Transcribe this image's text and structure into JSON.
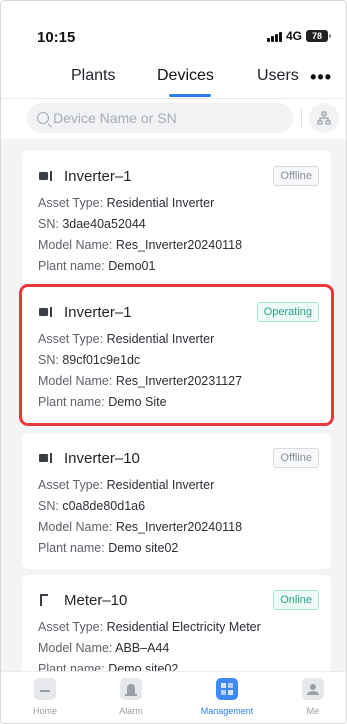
{
  "status_bar": {
    "time": "10:15",
    "network": "4G",
    "battery": "78"
  },
  "tabs": [
    {
      "label": "Plants",
      "active": false
    },
    {
      "label": "Devices",
      "active": true
    },
    {
      "label": "Users",
      "active": false
    }
  ],
  "more_label": "•••",
  "search": {
    "placeholder": "Device Name or SN",
    "value": ""
  },
  "labels": {
    "asset_type": "Asset Type:",
    "sn": "SN:",
    "model_name": "Model Name:",
    "plant_name": "Plant name:"
  },
  "devices": [
    {
      "name": "Inverter–1",
      "status": "Offline",
      "asset_type": "Residential Inverter",
      "sn": "3dae40a52044",
      "model_name": "Res_Inverter20240118",
      "plant_name": "Demo01",
      "icon": "inverter-icon"
    },
    {
      "name": "Inverter–1",
      "status": "Operating",
      "asset_type": "Residential Inverter",
      "sn": "89cf01c9e1dc",
      "model_name": "Res_Inverter20231127",
      "plant_name": "Demo Site",
      "icon": "inverter-icon",
      "selected": true
    },
    {
      "name": "Inverter–10",
      "status": "Offline",
      "asset_type": "Residential Inverter",
      "sn": "c0a8de80d1a6",
      "model_name": "Res_Inverter20240118",
      "plant_name": "Demo site02",
      "icon": "inverter-icon"
    },
    {
      "name": "Meter–10",
      "status": "Online",
      "asset_type": "Residential Electricity Meter",
      "model_name": "ABB–A44",
      "plant_name": "Demo site02",
      "icon": "meter-icon"
    }
  ],
  "bottom_nav": [
    {
      "label": "Home",
      "icon": "home-icon",
      "active": false
    },
    {
      "label": "Alarm",
      "icon": "alarm-icon",
      "active": false
    },
    {
      "label": "Management",
      "icon": "management-icon",
      "active": true
    },
    {
      "label": "Me",
      "icon": "user-icon",
      "active": false
    }
  ],
  "colors": {
    "accent": "#2f7cf6",
    "selection_border": "#e8393b",
    "operating": "#2ea08a"
  }
}
